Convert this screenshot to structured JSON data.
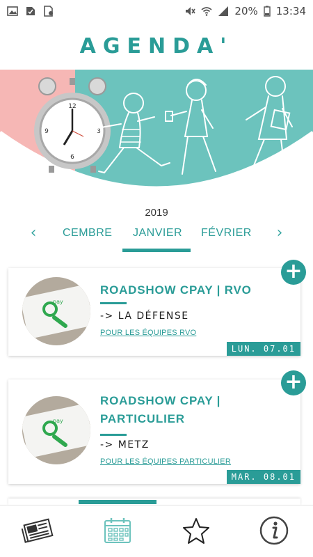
{
  "status_bar": {
    "battery": "20%",
    "time": "13:34"
  },
  "app": {
    "logo_text": "AGENDA'"
  },
  "calendar": {
    "year": "2019",
    "months": {
      "previous": "CEMBRE",
      "current": "JANVIER",
      "next": "FÉVRIER"
    }
  },
  "events": [
    {
      "title": "ROADSHOW CPAY | RVO",
      "location": "-> LA DÉFENSE",
      "audience": "POUR LES ÉQUIPES RVO",
      "date": "LUN. 07.01"
    },
    {
      "title": "ROADSHOW CPAY | PARTICULIER",
      "location": "-> METZ",
      "audience": "POUR LES ÉQUIPES PARTICULIER",
      "date": "MAR. 08.01"
    }
  ],
  "icons": {
    "add": "plus-icon",
    "thumb_logo": "pay"
  },
  "colors": {
    "accent": "#2a9c97",
    "hero_teal": "#6cc3bd",
    "hero_pink": "#f6b7b5"
  }
}
